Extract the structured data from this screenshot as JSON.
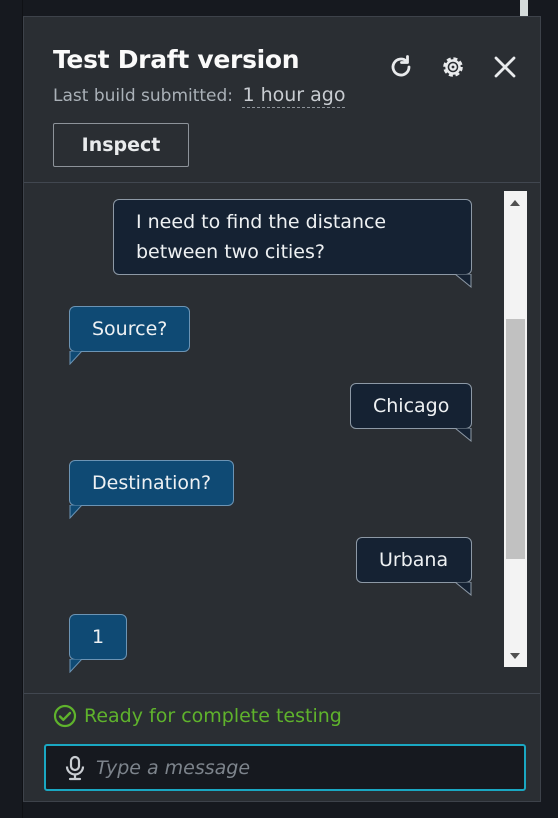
{
  "header": {
    "title": "Test Draft version",
    "build_label": "Last build submitted:",
    "build_time": "1 hour ago",
    "refresh_icon": "refresh-icon",
    "settings_icon": "gear-icon",
    "close_icon": "close-icon"
  },
  "inspect_label": "Inspect",
  "messages": [
    {
      "role": "user",
      "lines": [
        "I need to find the distance",
        "between two cities?"
      ]
    },
    {
      "role": "bot",
      "text": "Source?"
    },
    {
      "role": "user",
      "text": "Chicago"
    },
    {
      "role": "bot",
      "text": "Destination?"
    },
    {
      "role": "user",
      "text": "Urbana"
    },
    {
      "role": "bot",
      "text": "1"
    }
  ],
  "status": {
    "text": "Ready for complete testing",
    "icon": "check-circle-icon",
    "color": "#5fb32c"
  },
  "input": {
    "placeholder": "Type a message",
    "value": "",
    "icon": "microphone-icon"
  },
  "colors": {
    "user_bubble": "#152233",
    "bot_bubble": "#0f4a74",
    "input_border": "#1aa7c2"
  }
}
